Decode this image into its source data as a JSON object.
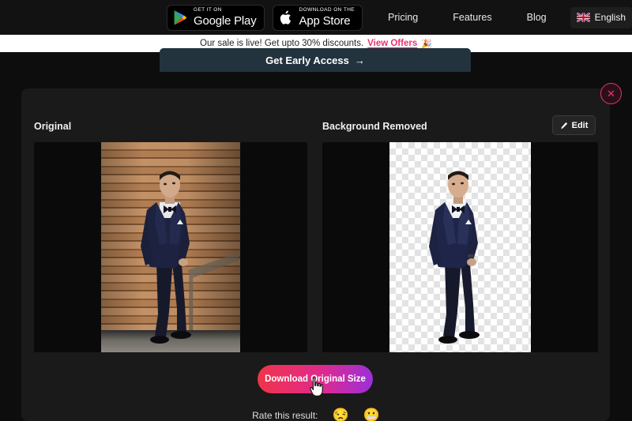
{
  "navbar": {
    "google_play": {
      "small": "GET IT ON",
      "big": "Google Play",
      "icon": "google-play-icon"
    },
    "app_store": {
      "small": "Download on the",
      "big": "App Store",
      "icon": "apple-icon"
    },
    "links": [
      {
        "label": "Pricing"
      },
      {
        "label": "Features"
      },
      {
        "label": "Blog"
      }
    ],
    "language": {
      "label": "English",
      "flag": "uk-flag-icon"
    }
  },
  "sale_banner": {
    "text": "Our sale is live! Get upto 30% discounts.",
    "link": "View Offers",
    "emoji": "🎉"
  },
  "early_access": {
    "label": "Get Early Access",
    "arrow": "→"
  },
  "modal": {
    "close_icon": "close-icon",
    "left_panel": {
      "title": "Original"
    },
    "right_panel": {
      "title": "Background Removed",
      "edit_label": "Edit",
      "edit_icon": "pencil-icon"
    },
    "download_label": "Download Original Size",
    "rate": {
      "label": "Rate this result:",
      "emojis": [
        "😒",
        "😬"
      ]
    }
  },
  "colors": {
    "page_bg": "#0d0d0d",
    "card_bg": "#1a1a1a",
    "navbar_bg": "#121212",
    "banner_bg": "#ffffff",
    "accent_pink": "#e8336d",
    "early_access_bg": "#22333d",
    "download_gradient_start": "#f0344a",
    "download_gradient_mid": "#e02a8c",
    "download_gradient_end": "#9b30d9"
  }
}
